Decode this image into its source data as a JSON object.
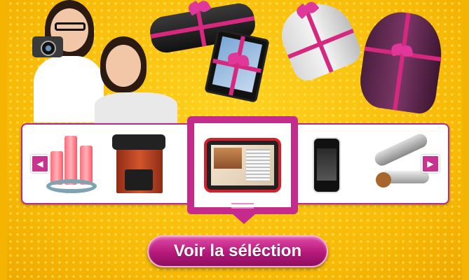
{
  "carousel": {
    "prev_arrow": "◀",
    "next_arrow": "▶",
    "products": [
      {
        "name": "led-candles"
      },
      {
        "name": "espresso-machine"
      },
      {
        "name": "kitchen-tablet"
      },
      {
        "name": "smartphone"
      },
      {
        "name": "hair-styler"
      }
    ],
    "selected_index": 2
  },
  "cta": {
    "label": "Voir la séléction"
  },
  "colors": {
    "background": "#f9c10a",
    "accent": "#c42b8c",
    "ribbon": "#d6287f"
  }
}
